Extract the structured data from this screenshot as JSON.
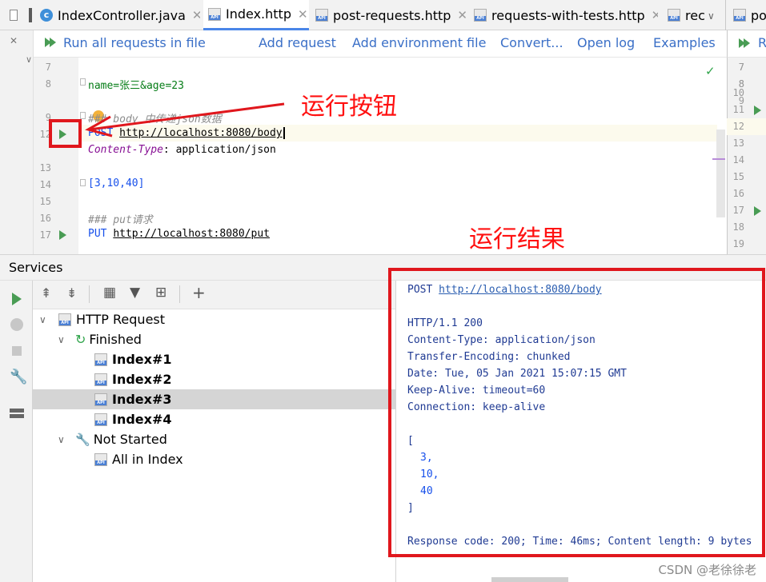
{
  "tabs": [
    {
      "label": "IndexController.java",
      "icon": "java-class-icon"
    },
    {
      "label": "Index.http",
      "icon": "http-api-icon",
      "active": true
    },
    {
      "label": "post-requests.http",
      "icon": "http-api-icon"
    },
    {
      "label": "requests-with-tests.http",
      "icon": "http-api-icon"
    },
    {
      "label": "rec",
      "icon": "http-api-icon"
    },
    {
      "label": "po",
      "icon": "http-api-icon"
    }
  ],
  "toolbar": {
    "run_all": "Run all requests in file",
    "add_request": "Add request",
    "add_env": "Add environment file",
    "convert": "Convert...",
    "open_log": "Open log",
    "examples": "Examples",
    "run_cut": "R"
  },
  "editor": {
    "lines": [
      "7",
      "8",
      "9",
      "12",
      "13",
      "14",
      "15",
      "16",
      "17"
    ],
    "line8": "name=张三&age=23",
    "line9_comment": "### body 中传递json数据",
    "line12_method": "POST",
    "line12_url": "http://localhost:8080/body",
    "line13_header": "Content-Type",
    "line13_value": ": application/json",
    "line14": "[3,10,40]",
    "line16_comment": "### put请求",
    "line17_method": "PUT",
    "line17_url": "http://localhost:8080/put"
  },
  "right_gutter_lines": [
    "7",
    "8",
    "9",
    "10",
    "11",
    "12",
    "13",
    "14",
    "15",
    "16",
    "17",
    "18",
    "19"
  ],
  "annotations": {
    "run_button": "运行按钮",
    "run_result": "运行结果"
  },
  "services": {
    "title": "Services",
    "tree": {
      "root": "HTTP Request",
      "finished": "Finished",
      "items": [
        "Index#1",
        "Index#2",
        "Index#3",
        "Index#4"
      ],
      "not_started": "Not Started",
      "all": "All in Index"
    }
  },
  "response": {
    "request_method": "POST",
    "request_url": "http://localhost:8080/body",
    "status": "HTTP/1.1 200",
    "headers": [
      "Content-Type: application/json",
      "Transfer-Encoding: chunked",
      "Date: Tue, 05 Jan 2021 15:07:15 GMT",
      "Keep-Alive: timeout=60",
      "Connection: keep-alive"
    ],
    "body_open": "[",
    "body_values": [
      "3,",
      "10,",
      "40"
    ],
    "body_close": "]",
    "summary": "Response code: 200; Time: 46ms; Content length: 9 bytes"
  },
  "watermark": "CSDN @老徐徐老",
  "colors": {
    "accent": "#3a6fc7",
    "annotation": "#e0171d",
    "run_green": "#499c54"
  }
}
